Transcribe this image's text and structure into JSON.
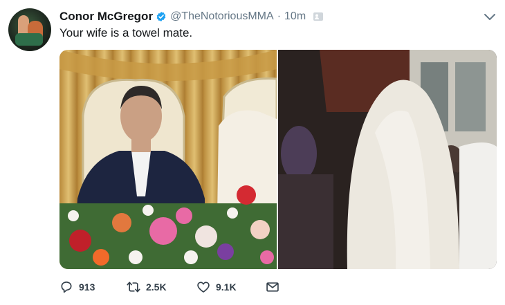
{
  "tweet": {
    "author_name": "Conor McGregor",
    "handle": "@TheNotoriousMMA",
    "separator": "·",
    "time": "10m",
    "text": "Your wife is a towel mate.",
    "colors": {
      "text": "#14171a",
      "muted": "#657786",
      "verified": "#1da1f2"
    }
  },
  "icons": {
    "verified": "verified-badge-icon",
    "follow": "follows-you-icon",
    "caret": "chevron-down-icon",
    "reply": "reply-icon",
    "retweet": "retweet-icon",
    "like": "heart-icon",
    "dm": "envelope-icon"
  },
  "actions": {
    "reply_count": "913",
    "retweet_count": "2.5K",
    "like_count": "9.1K"
  }
}
